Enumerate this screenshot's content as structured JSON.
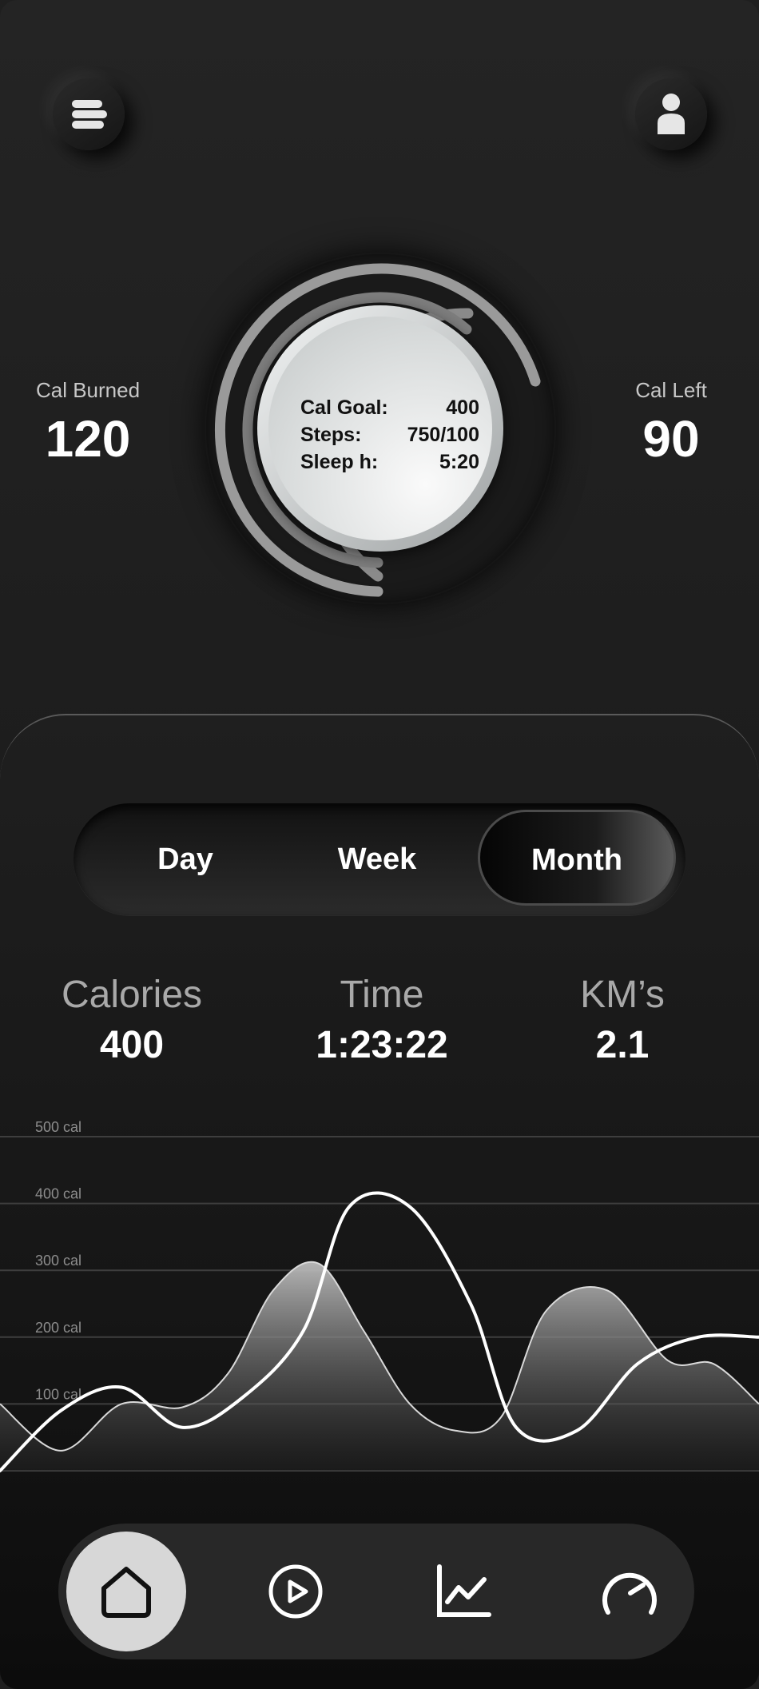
{
  "stats": {
    "left": {
      "label": "Cal Burned",
      "value": "120"
    },
    "right": {
      "label": "Cal Left",
      "value": "90"
    }
  },
  "dial": {
    "rows": [
      {
        "label": "Cal Goal:",
        "value": "400"
      },
      {
        "label": "Steps:",
        "value": "750/100"
      },
      {
        "label": "Sleep h:",
        "value": "5:20"
      }
    ]
  },
  "tabs": {
    "day": "Day",
    "week": "Week",
    "month": "Month",
    "selected": "Month"
  },
  "metrics": [
    {
      "label": "Calories",
      "value": "400"
    },
    {
      "label": "Time",
      "value": "1:23:22"
    },
    {
      "label": "KM’s",
      "value": "2.1"
    }
  ],
  "chart_data": {
    "type": "area",
    "y_tick_labels": [
      "500 cal",
      "400 cal",
      "300 cal",
      "200 cal",
      "100 cal"
    ],
    "y_ticks": [
      500,
      400,
      300,
      200,
      100
    ],
    "ylim": [
      0,
      500
    ],
    "grid": true,
    "series": [
      {
        "style": "filled-area",
        "points": [
          [
            0,
            100
          ],
          [
            4,
            30
          ],
          [
            8,
            100
          ],
          [
            12,
            95
          ],
          [
            15,
            145
          ],
          [
            18,
            270
          ],
          [
            21,
            310
          ],
          [
            24,
            208
          ],
          [
            27,
            100
          ],
          [
            30,
            60
          ],
          [
            33,
            80
          ],
          [
            36,
            240
          ],
          [
            40,
            270
          ],
          [
            44,
            165
          ],
          [
            47,
            160
          ],
          [
            50,
            100
          ]
        ]
      },
      {
        "style": "line",
        "points": [
          [
            0,
            0
          ],
          [
            4,
            90
          ],
          [
            8,
            125
          ],
          [
            12,
            65
          ],
          [
            16,
            110
          ],
          [
            20,
            210
          ],
          [
            23,
            395
          ],
          [
            27,
            395
          ],
          [
            31,
            250
          ],
          [
            34,
            65
          ],
          [
            38,
            60
          ],
          [
            42,
            160
          ],
          [
            46,
            200
          ],
          [
            50,
            200
          ]
        ]
      }
    ]
  },
  "nav": {
    "items": [
      {
        "icon": "home-icon",
        "active": true
      },
      {
        "icon": "play-icon",
        "active": false
      },
      {
        "icon": "chart-icon",
        "active": false
      },
      {
        "icon": "speedometer-icon",
        "active": false
      }
    ]
  },
  "colors": {
    "background": "#1f1f1f",
    "text": "#ffffff",
    "muted": "#a9a9a9",
    "active_nav": "#d7d7d7"
  }
}
